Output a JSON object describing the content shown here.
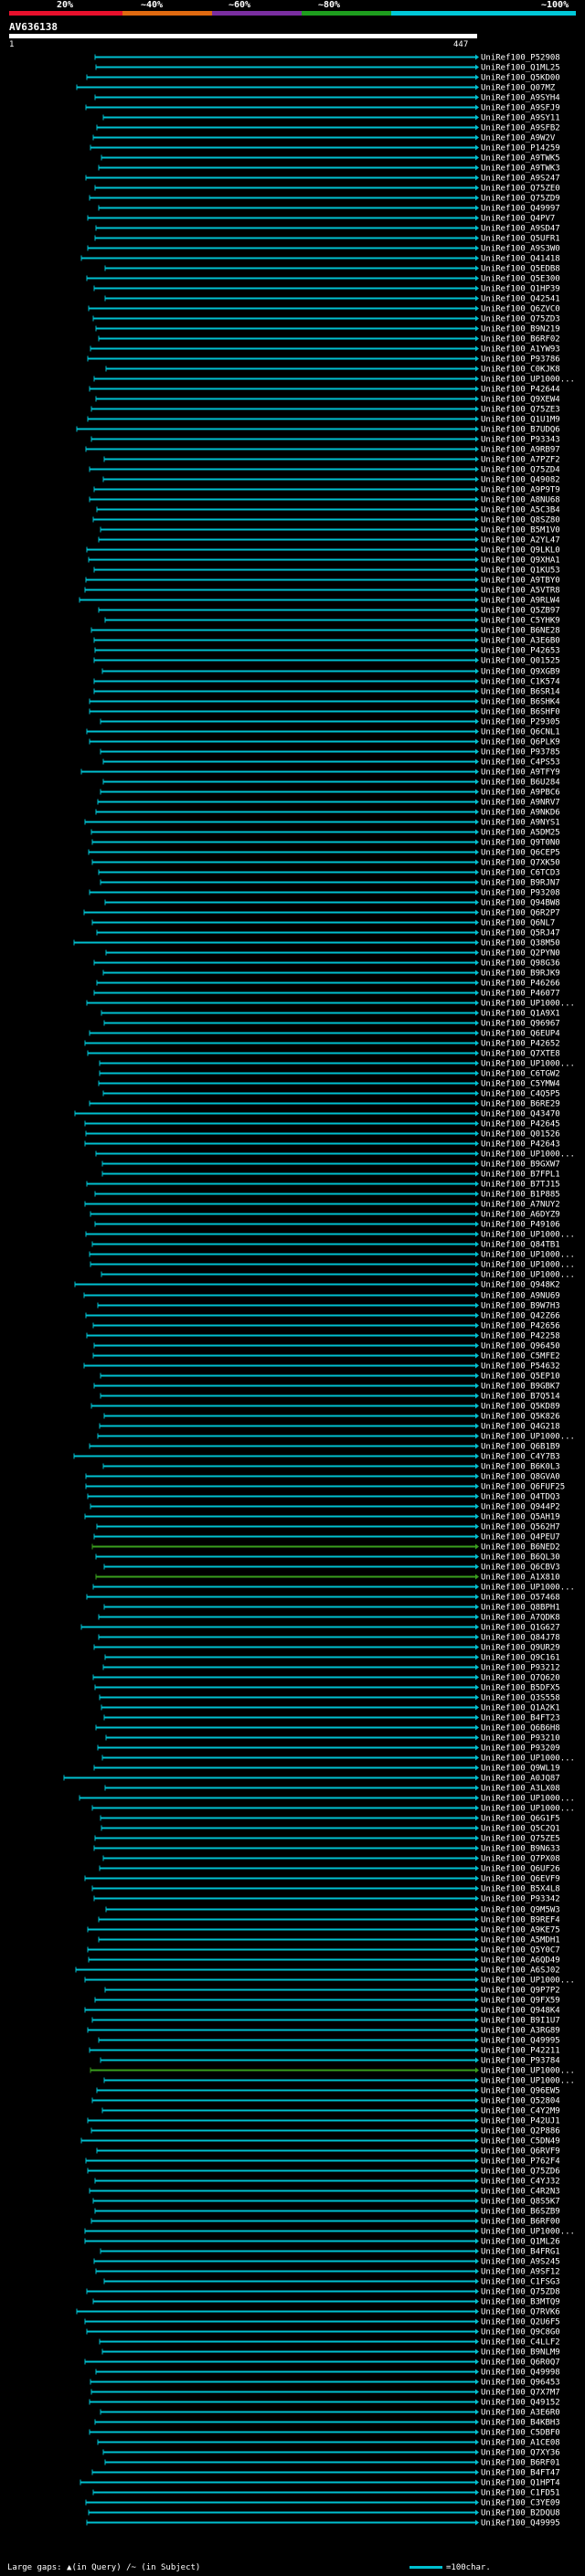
{
  "scale": {
    "labels": [
      "20%",
      "~40%",
      "~60%",
      "~80%",
      "~100%"
    ],
    "colors": [
      "#e8102c",
      "#e06a10",
      "#7a2ea0",
      "#1e9e1e",
      "#00c8d8"
    ]
  },
  "query": {
    "title": "AV636138",
    "start": "1",
    "end": "447"
  },
  "hits": [
    "UniRef100_P52908",
    "UniRef100_Q1ML25",
    "UniRef100_Q5KD00",
    "UniRef100_Q07MZ",
    "UniRef100_A9SYH4",
    "UniRef100_A9SFJ9",
    "UniRef100_A9SY11",
    "UniRef100_A9SFB2",
    "UniRef100_A9W2V",
    "UniRef100_P14259",
    "UniRef100_A9TWK5",
    "UniRef100_A9TWK3",
    "UniRef100_A9S247",
    "UniRef100_Q75ZE0",
    "UniRef100_Q75ZD9",
    "UniRef100_Q49997",
    "UniRef100_Q4PV7",
    "UniRef100_A9SD47",
    "UniRef100_Q5UFR1",
    "UniRef100_A9S3W0",
    "UniRef100_Q41418",
    "UniRef100_Q5EDB8",
    "UniRef100_Q5E300",
    "UniRef100_Q1HP39",
    "UniRef100_Q42541",
    "UniRef100_Q6ZVC0",
    "UniRef100_Q75ZD3",
    "UniRef100_B9N219",
    "UniRef100_B6RF02",
    "UniRef100_A1YW93",
    "UniRef100_P93786",
    "UniRef100_C0KJK8",
    "UniRef100_UP1000...",
    "UniRef100_P42644",
    "UniRef100_Q9XEW4",
    "UniRef100_Q75ZE3",
    "UniRef100_Q1U1M9",
    "UniRef100_B7UDQ6",
    "UniRef100_P93343",
    "UniRef100_A9RB97",
    "UniRef100_A7PZF2",
    "UniRef100_Q75ZD4",
    "UniRef100_Q49082",
    "UniRef100_A9P9T9",
    "UniRef100_A8NU68",
    "UniRef100_A5C3B4",
    "UniRef100_Q8SZ80",
    "UniRef100_B5M1V0",
    "UniRef100_A2YL47",
    "UniRef100_Q9LKL0",
    "UniRef100_Q9XHA1",
    "UniRef100_Q1KU53",
    "UniRef100_A9TBY0",
    "UniRef100_A5VTR8",
    "UniRef100_A9RLW4",
    "UniRef100_Q5ZB97",
    "UniRef100_C5YHK9",
    "UniRef100_B6NE28",
    "UniRef100_A3E6B0",
    "UniRef100_P42653",
    "UniRef100_Q01525",
    "UniRef100_Q9XGB9",
    "UniRef100_C1K574",
    "UniRef100_B6SR14",
    "UniRef100_B6SHK4",
    "UniRef100_B6SHF0",
    "UniRef100_P29305",
    "UniRef100_Q6CNL1",
    "UniRef100_Q6PLK9",
    "UniRef100_P93785",
    "UniRef100_C4PS53",
    "UniRef100_A9TFY9",
    "UniRef100_B6U284",
    "UniRef100_A9PBC6",
    "UniRef100_A9NRV7",
    "UniRef100_A9NKD6",
    "UniRef100_A9NYS1",
    "UniRef100_A5DM25",
    "UniRef100_Q9T0N0",
    "UniRef100_Q6CEP5",
    "UniRef100_Q7XK50",
    "UniRef100_C6TCD3",
    "UniRef100_B9RJN7",
    "UniRef100_P93208",
    "UniRef100_Q94BW8",
    "UniRef100_Q6R2P7",
    "UniRef100_Q6NL7",
    "UniRef100_Q5RJ47",
    "UniRef100_Q38M50",
    "UniRef100_Q2PYN0",
    "UniRef100_Q98G36",
    "UniRef100_B9RJK9",
    "UniRef100_P46266",
    "UniRef100_P46077",
    "UniRef100_UP1000...",
    "UniRef100_Q1A9X1",
    "UniRef100_Q96967",
    "UniRef100_Q6EUP4",
    "UniRef100_P42652",
    "UniRef100_Q7XTE8",
    "UniRef100_UP1000...",
    "UniRef100_C6TGW2",
    "UniRef100_C5YMW4",
    "UniRef100_C4Q5P5",
    "UniRef100_B6RE29",
    "UniRef100_Q43470",
    "UniRef100_P42645",
    "UniRef100_Q01526",
    "UniRef100_P42643",
    "UniRef100_UP1000...",
    "UniRef100_B9GXW7",
    "UniRef100_B7FPL1",
    "UniRef100_B7TJ15",
    "UniRef100_B1P885",
    "UniRef100_A7NUY2",
    "UniRef100_A6DYZ9",
    "UniRef100_P49106",
    "UniRef100_UP1000...",
    "UniRef100_Q84TB1",
    "UniRef100_UP1000...",
    "UniRef100_UP1000...",
    "UniRef100_UP1000...",
    "UniRef100_Q948K2",
    "UniRef100_A9NU69",
    "UniRef100_B9W7H3",
    "UniRef100_Q42Z66",
    "UniRef100_P42656",
    "UniRef100_P42258",
    "UniRef100_Q96450",
    "UniRef100_C5MFE2",
    "UniRef100_P54632",
    "UniRef100_Q5EP10",
    "UniRef100_B9GBK7",
    "UniRef100_B7Q514",
    "UniRef100_Q5KD89",
    "UniRef100_Q5K826",
    "UniRef100_Q4G218",
    "UniRef100_UP1000...",
    "UniRef100_Q6B1B9",
    "UniRef100_C4Y7B3",
    "UniRef100_B6K0L3",
    "UniRef100_Q8GVA0",
    "UniRef100_Q6FUF25",
    "UniRef100_Q4TDQ3",
    "UniRef100_Q944P2",
    "UniRef100_Q5AH19",
    "UniRef100_Q562H7",
    "UniRef100_Q4PEU7",
    "UniRef100_B6NED2",
    "UniRef100_B6QL30",
    "UniRef100_Q6CBV3",
    "UniRef100_A1X810",
    "UniRef100_UP1000...",
    "UniRef100_O57468",
    "UniRef100_Q8BPH1",
    "UniRef100_A7QDK8",
    "UniRef100_Q1G627",
    "UniRef100_Q84J78",
    "UniRef100_Q9UR29",
    "UniRef100_Q9C161",
    "UniRef100_P93212",
    "UniRef100_Q7Q620",
    "UniRef100_B5DFX5",
    "UniRef100_Q3S558",
    "UniRef100_Q1A2K1",
    "UniRef100_B4FT23",
    "UniRef100_Q6B6H8",
    "UniRef100_P93210",
    "UniRef100_P93209",
    "UniRef100_UP1000...",
    "UniRef100_Q9WL19",
    "UniRef100_A0JQ87",
    "UniRef100_A3LX08",
    "UniRef100_UP1000...",
    "UniRef100_UP1000...",
    "UniRef100_Q6G1F5",
    "UniRef100_Q5C2Q1",
    "UniRef100_Q75ZE5",
    "UniRef100_B9N633",
    "UniRef100_Q7PX08",
    "UniRef100_Q6UF26",
    "UniRef100_Q6EVF9",
    "UniRef100_B5X4L8",
    "UniRef100_P93342",
    "UniRef100_Q9M5W3",
    "UniRef100_B9REF4",
    "UniRef100_A9KE75",
    "UniRef100_A5MDH1",
    "UniRef100_Q5Y0C7",
    "UniRef100_A6QD49",
    "UniRef100_A6SJ02",
    "UniRef100_UP1000...",
    "UniRef100_Q9P7P2",
    "UniRef100_Q9FX59",
    "UniRef100_Q948K4",
    "UniRef100_B9I1U7",
    "UniRef100_A3RG89",
    "UniRef100_Q49995",
    "UniRef100_P42211",
    "UniRef100_P93784",
    "UniRef100_UP1000...",
    "UniRef100_UP1000...",
    "UniRef100_Q96EW5",
    "UniRef100_Q52804",
    "UniRef100_C4Y2M9",
    "UniRef100_P42UJ1",
    "UniRef100_Q2P886",
    "UniRef100_C5DN49",
    "UniRef100_Q6RVF9",
    "UniRef100_P762F4",
    "UniRef100_Q75ZD6",
    "UniRef100_C4YJ32",
    "UniRef100_C4R2N3",
    "UniRef100_Q8S5K7",
    "UniRef100_B6SZB9",
    "UniRef100_B6RF00",
    "UniRef100_UP1000...",
    "UniRef100_Q1ML26",
    "UniRef100_B4FRG1",
    "UniRef100_A9S245",
    "UniRef100_A9SF12",
    "UniRef100_C1FSG3",
    "UniRef100_Q75ZD8",
    "UniRef100_B3MTQ9",
    "UniRef100_Q7RVK6",
    "UniRef100_Q2U6F5",
    "UniRef100_Q9C8G0",
    "UniRef100_C4LLF2",
    "UniRef100_B9NLM9",
    "UniRef100_Q6R0Q7",
    "UniRef100_Q49998",
    "UniRef100_Q96453",
    "UniRef100_Q7X7M7",
    "UniRef100_Q49152",
    "UniRef100_A3E6R0",
    "UniRef100_B4KBH3",
    "UniRef100_C5DBF0",
    "UniRef100_A1CE08",
    "UniRef100_Q7XY36",
    "UniRef100_B6RF01",
    "UniRef100_B4FT47",
    "UniRef100_Q1HPT4",
    "UniRef100_C1FD51",
    "UniRef100_C3YE09",
    "UniRef100_B2DQU8",
    "UniRef100_Q49995"
  ],
  "legend": {
    "large_gaps": "Large gaps:",
    "query_gap": "(in Query)",
    "subject_gap": "(in Subject)",
    "separator": "/~",
    "scale_note": "=100char."
  },
  "colors": {
    "background": "#000000",
    "hit_line": "#00c0d0",
    "highlight_line": "#3a9e1e",
    "query_bar": "#ffffff"
  }
}
